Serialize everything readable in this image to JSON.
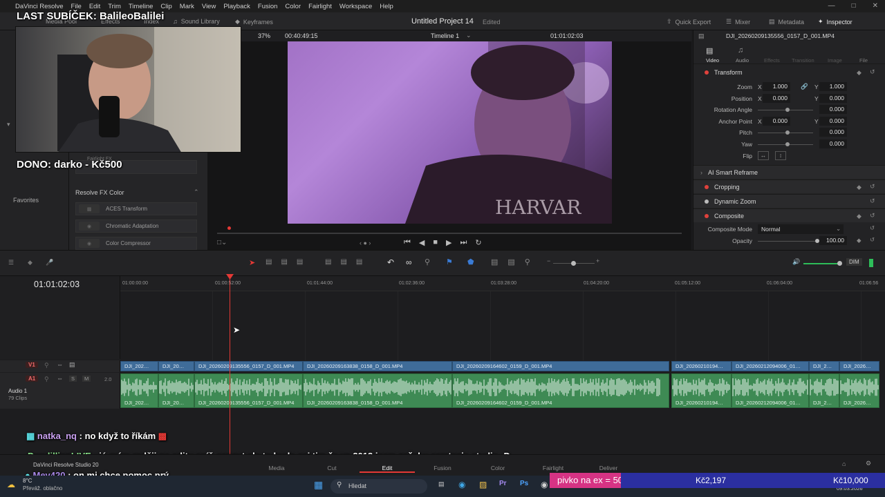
{
  "menu": [
    "DaVinci Resolve",
    "File",
    "Edit",
    "Trim",
    "Timeline",
    "Clip",
    "Mark",
    "View",
    "Playback",
    "Fusion",
    "Color",
    "Fairlight",
    "Workspace",
    "Help"
  ],
  "toolbar": {
    "media_pool": "Media Pool",
    "effects": "Effects",
    "index": "Index",
    "sound_library": "Sound Library",
    "keyframes": "Keyframes",
    "project_title": "Untitled Project 14",
    "edited": "Edited",
    "quick_export": "Quick Export",
    "mixer": "Mixer",
    "metadata": "Metadata",
    "inspector": "Inspector"
  },
  "overlay": {
    "sub_title": "LAST SUBÍČEK: BalileoBalilei",
    "dono": "DONO: darko - Kč500"
  },
  "effects_panel": {
    "fairlight_fx": "Fairlight FX",
    "section": "Resolve FX Color",
    "favorites": "Favorites",
    "items": [
      "ACES Transform",
      "Chromatic Adaptation",
      "Color Compressor"
    ]
  },
  "viewer": {
    "zoom": "37%",
    "duration": "00:40:49:15",
    "timeline_name": "Timeline 1",
    "timecode": "01:01:02:03"
  },
  "inspector": {
    "clip_name": "DJI_20260209135556_0157_D_001.MP4",
    "tabs": [
      "Video",
      "Audio",
      "Effects",
      "Transition",
      "Image",
      "File"
    ],
    "transform": "Transform",
    "zoom_label": "Zoom",
    "zoom_x": "1.000",
    "zoom_y": "1.000",
    "position_label": "Position",
    "position_x": "0.000",
    "position_y": "0.000",
    "rotation_label": "Rotation Angle",
    "rotation": "0.000",
    "anchor_label": "Anchor Point",
    "anchor_x": "0.000",
    "anchor_y": "0.000",
    "pitch_label": "Pitch",
    "pitch": "0.000",
    "yaw_label": "Yaw",
    "yaw": "0.000",
    "flip_label": "Flip",
    "x": "X",
    "y": "Y",
    "ai_reframe": "AI Smart Reframe",
    "cropping": "Cropping",
    "dynamic_zoom": "Dynamic Zoom",
    "composite": "Composite",
    "composite_mode_label": "Composite Mode",
    "composite_mode": "Normal",
    "opacity_label": "Opacity",
    "opacity": "100.00"
  },
  "timeline": {
    "timecode": "01:01:02:03",
    "ruler": [
      "01:00:00:00",
      "01:00:52:00",
      "01:01:44:00",
      "01:02:36:00",
      "01:03:28:00",
      "01:04:20:00",
      "01:05:12:00",
      "01:06:04:00",
      "01:06:56"
    ],
    "v1": "V1",
    "a1": "A1",
    "audio_name": "Audio 1",
    "audio_clips": "79 Clips",
    "audio_level": "2.0",
    "dim": "DIM",
    "clips": [
      {
        "label": "DJI_202…"
      },
      {
        "label": "DJI_20…"
      },
      {
        "label": "DJI_20260209135556_0157_D_001.MP4"
      },
      {
        "label": "DJI_20260209163838_0158_D_001.MP4"
      },
      {
        "label": "DJI_20260209164602_0159_D_001.MP4"
      },
      {
        "label": "DJI_20260210194…"
      },
      {
        "label": "DJI_20260212094006_01…"
      },
      {
        "label": "DJI_2…"
      },
      {
        "label": "DJI_2026…"
      }
    ]
  },
  "chat": [
    {
      "user": "natka_nq",
      "text": ": no když to říkám"
    },
    {
      "user": "DandillionLIVE",
      "text": ": já mám raději na edity spíš capcut ale to bude asi tim že ve 2013 jsem začal v camtasia studio :D"
    },
    {
      "user": "Mev420",
      "text": ": on mi chce pomoc prý"
    }
  ],
  "pages": {
    "brand": "DaVinci Resolve Studio 20",
    "items": [
      "Media",
      "Cut",
      "Edit",
      "Fusion",
      "Color",
      "Fairlight",
      "Deliver"
    ],
    "active": "Edit"
  },
  "donation": {
    "left": "pivko na ex = 500,-",
    "current": "Kč2,197",
    "goal": "Kč10,000"
  },
  "taskbar": {
    "weather_temp": "8°C",
    "weather_desc": "Převáž. oblačno",
    "search": "Hledat",
    "date": "09.03.2026"
  },
  "colors": {
    "accent": "#e0413c",
    "clip_video": "#3f6c99",
    "clip_audio": "#3e8a54",
    "donation": "#d63384",
    "goal_bar": "#2b2fa0"
  }
}
